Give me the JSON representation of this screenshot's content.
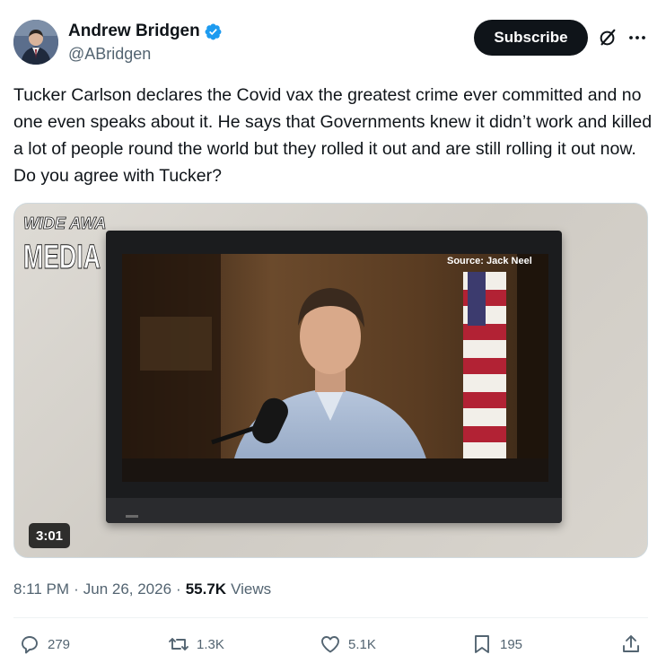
{
  "author": {
    "display_name": "Andrew Bridgen",
    "handle": "@ABridgen",
    "verified_badge_color": "#1d9bf0"
  },
  "header_actions": {
    "subscribe_label": "Subscribe",
    "grok_icon": "grok-icon",
    "more_icon": "more-horizontal-icon"
  },
  "tweet": {
    "text": "Tucker Carlson declares the Covid vax the greatest crime ever committed and no one even speaks about it.  He says that Governments knew it didn’t work and killed a lot of people round the world but they rolled it out and are still rolling it out now. Do you agree with Tucker?"
  },
  "media": {
    "watermark_line1": "WIDE AWAKE",
    "watermark_line2": "MEDIA",
    "source_caption": "Source: Jack Neel",
    "duration": "3:01"
  },
  "meta": {
    "time": "8:11 PM",
    "separator1": "·",
    "date": "Jun 26, 2026",
    "separator2": "·",
    "views_count": "55.7K",
    "views_label": "Views"
  },
  "actions": {
    "replies": "279",
    "reposts": "1.3K",
    "likes": "5.1K",
    "bookmarks": "195"
  }
}
